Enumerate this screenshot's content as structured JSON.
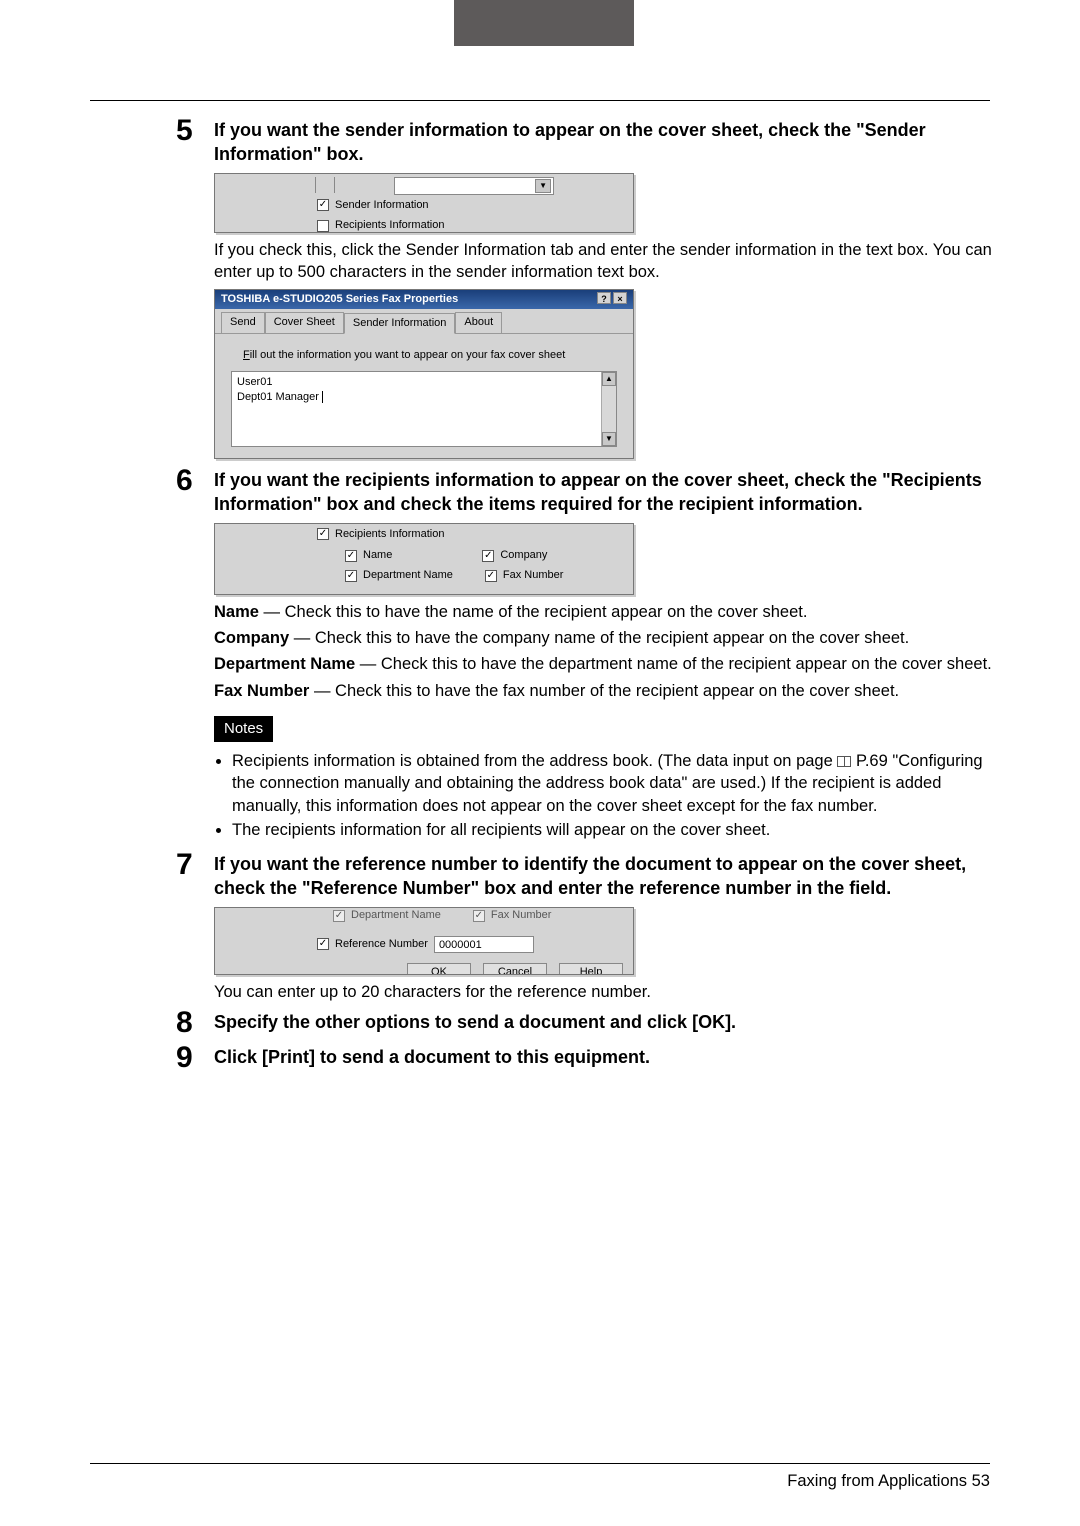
{
  "steps": {
    "s5": {
      "num": "5",
      "title": "If you want the sender information to appear on the cover sheet, check the \"Sender Information\" box.",
      "paragraph": "If you check this, click the Sender Information tab and enter the sender information in the text box. You can enter up to 500 characters in the sender information text box."
    },
    "s6": {
      "num": "6",
      "title": "If you want the recipients information to appear on the cover sheet, check the \"Recipients Information\" box and check the items required for the recipient information.",
      "name_label": "Name",
      "name_text": " — Check this to have the name of the recipient appear on the cover sheet.",
      "company_label": "Company",
      "company_text": " — Check this to have the company name of the recipient appear on the cover sheet.",
      "dept_label": "Department Name",
      "dept_text": " — Check this to have the department name of the recipient appear on the cover sheet.",
      "fax_label": "Fax Number",
      "fax_text": " — Check this to have the fax number of the recipient appear on the cover sheet.",
      "notes_label": "Notes",
      "note1": "Recipients information is obtained from the address book. (The data input on page ",
      "note1b": " P.69 \"Configuring the connection manually and obtaining the address book data\" are used.) If the recipient is added manually, this information does not appear on the cover sheet except for the fax number.",
      "note2": "The recipients information for all recipients will appear on the cover sheet."
    },
    "s7": {
      "num": "7",
      "title": "If you want the reference number to identify the document to appear on the cover sheet, check the \"Reference Number\" box and enter the reference number in the field.",
      "paragraph": "You can enter up to 20 characters for the reference number."
    },
    "s8": {
      "num": "8",
      "title": "Specify the other options to send a document and click [OK]."
    },
    "s9": {
      "num": "9",
      "title": "Click [Print] to send a document to this equipment."
    }
  },
  "shot1": {
    "sender_info": "Sender Information",
    "recip_info": "Recipients Information"
  },
  "shot2": {
    "title": "TOSHIBA e-STUDIO205 Series Fax Properties",
    "tabs": {
      "send": "Send",
      "cover": "Cover Sheet",
      "sender": "Sender Information",
      "about": "About"
    },
    "hint": "Fill out the information you want to appear on your fax cover sheet",
    "line1": "User01",
    "line2": "Dept01 Manager"
  },
  "shot3": {
    "recip_info": "Recipients Information",
    "name": "Name",
    "company": "Company",
    "dept": "Department Name",
    "fax": "Fax Number"
  },
  "shot4": {
    "dept": "Department Name",
    "fax": "Fax Number",
    "ref": "Reference Number",
    "ref_value": "0000001",
    "ok": "OK",
    "cancel": "Cancel",
    "help": "Help"
  },
  "footer": {
    "text": "Faxing from Applications    53"
  }
}
